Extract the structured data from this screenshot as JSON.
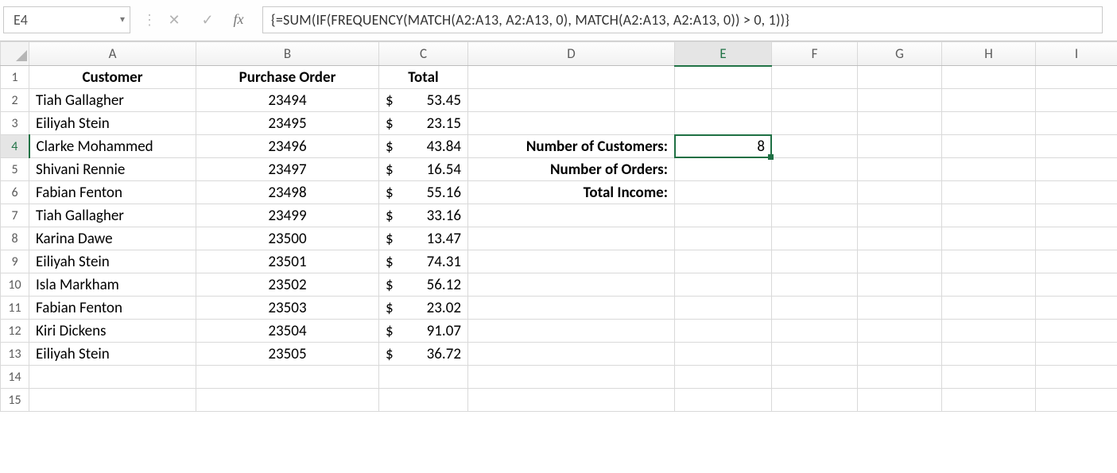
{
  "formula_bar": {
    "name_box": "E4",
    "fx_label": "fx",
    "formula": "{=SUM(IF(FREQUENCY(MATCH(A2:A13, A2:A13, 0), MATCH(A2:A13, A2:A13, 0)) > 0, 1))}"
  },
  "columns": [
    "A",
    "B",
    "C",
    "D",
    "E",
    "F",
    "G",
    "H",
    "I"
  ],
  "headers": {
    "A": "Customer",
    "B": "Purchase Order",
    "C": "Total"
  },
  "rows": [
    {
      "n": 1
    },
    {
      "n": 2,
      "customer": "Tiah Gallagher",
      "po": "23494",
      "total": "53.45"
    },
    {
      "n": 3,
      "customer": "Eiliyah Stein",
      "po": "23495",
      "total": "23.15"
    },
    {
      "n": 4,
      "customer": "Clarke Mohammed",
      "po": "23496",
      "total": "43.84",
      "D": "Number of Customers:",
      "E": "8"
    },
    {
      "n": 5,
      "customer": "Shivani Rennie",
      "po": "23497",
      "total": "16.54",
      "D": "Number of Orders:"
    },
    {
      "n": 6,
      "customer": "Fabian Fenton",
      "po": "23498",
      "total": "55.16",
      "D": "Total Income:"
    },
    {
      "n": 7,
      "customer": "Tiah Gallagher",
      "po": "23499",
      "total": "33.16"
    },
    {
      "n": 8,
      "customer": "Karina Dawe",
      "po": "23500",
      "total": "13.47"
    },
    {
      "n": 9,
      "customer": "Eiliyah Stein",
      "po": "23501",
      "total": "74.31"
    },
    {
      "n": 10,
      "customer": "Isla Markham",
      "po": "23502",
      "total": "56.12"
    },
    {
      "n": 11,
      "customer": "Fabian Fenton",
      "po": "23503",
      "total": "23.02"
    },
    {
      "n": 12,
      "customer": "Kiri Dickens",
      "po": "23504",
      "total": "91.07"
    },
    {
      "n": 13,
      "customer": "Eiliyah Stein",
      "po": "23505",
      "total": "36.72"
    },
    {
      "n": 14
    },
    {
      "n": 15
    }
  ],
  "currency_symbol": "$",
  "selected": {
    "col": "E",
    "row": 4
  },
  "icons": {
    "dropdown": "▾",
    "sep": "⋮",
    "cancel": "✕",
    "enter": "✓"
  }
}
